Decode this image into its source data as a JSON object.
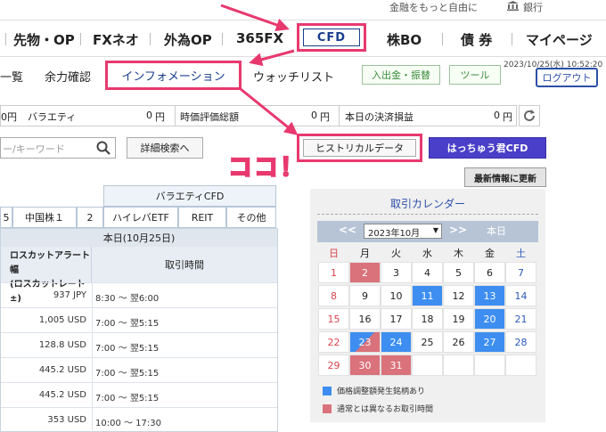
{
  "top": {
    "slogan": "金融をもっと自由に",
    "bank_label": "銀行"
  },
  "nav": {
    "items": [
      "先物・OP",
      "FXネオ",
      "外為OP",
      "365FX",
      "CFD",
      "株BO",
      "債 券",
      "マイページ"
    ]
  },
  "subnav": {
    "items": [
      "一覧",
      "余力確認",
      "インフォメーション",
      "ウォッチリスト"
    ],
    "deposit_label": "入出金・振替",
    "tool_label": "ツール",
    "timestamp": "2023/10/25(水) 10:52:20",
    "logout_label": "ログアウト"
  },
  "summary": {
    "cells": [
      {
        "label": "バラエティ",
        "prefix": "0円",
        "value": "0",
        "unit": "円"
      },
      {
        "label": "時価評価総額",
        "value": "0",
        "unit": "円"
      },
      {
        "label": "本日の決済損益",
        "value": "0",
        "unit": "円"
      }
    ]
  },
  "search": {
    "placeholder": "ー/キーワード",
    "detail_label": "詳細検索へ",
    "historical_label": "ヒストリカルデータ",
    "hacchu_label": "はっちゅう君CFD",
    "update_label": "最新情報に更新",
    "annotation": "ココ！"
  },
  "table": {
    "variety_header": "バラエティCFD",
    "tabs": [
      "5",
      "中国株１",
      "2",
      "ハイレバETF",
      "REIT",
      "その他"
    ],
    "today_label": "本日(10月25日)",
    "losscut_header_line1": "ロスカットアラート幅",
    "losscut_header_line2": "(ロスカットレート±)",
    "time_header": "取引時間",
    "rows": [
      {
        "value": "937 JPY",
        "time": "8:30 〜 翌6:00"
      },
      {
        "value": "1,005 USD",
        "time": "7:00 〜 翌5:15"
      },
      {
        "value": "128.8 USD",
        "time": "7:00 〜 翌5:15"
      },
      {
        "value": "445.2 USD",
        "time": "7:00 〜 翌5:15"
      },
      {
        "value": "445.2 USD",
        "time": "7:00 〜 翌5:15"
      },
      {
        "value": "353 USD",
        "time": "10:00 〜 17:30"
      }
    ]
  },
  "calendar": {
    "title": "取引カレンダー",
    "prev": "<<",
    "next": ">>",
    "month_select": "2023年10月",
    "today_label": "本日",
    "weekdays": [
      "日",
      "月",
      "火",
      "水",
      "木",
      "金",
      "土"
    ],
    "weeks": [
      [
        "1",
        "2",
        "3",
        "4",
        "5",
        "6",
        "7"
      ],
      [
        "8",
        "9",
        "10",
        "11",
        "12",
        "13",
        "14"
      ],
      [
        "15",
        "16",
        "17",
        "18",
        "19",
        "20",
        "21"
      ],
      [
        "22",
        "23",
        "24",
        "25",
        "26",
        "27",
        "28"
      ],
      [
        "29",
        "30",
        "31",
        "",
        "",
        "",
        ""
      ]
    ],
    "legend_blue": "価格調整額発生銘柄あり",
    "legend_red": "通常とは異なるお取引時間",
    "colors": {
      "blue": "#3d8ef0",
      "red": "#d9727a",
      "sunday": "#d9454e",
      "saturday": "#2c5ab8"
    }
  }
}
